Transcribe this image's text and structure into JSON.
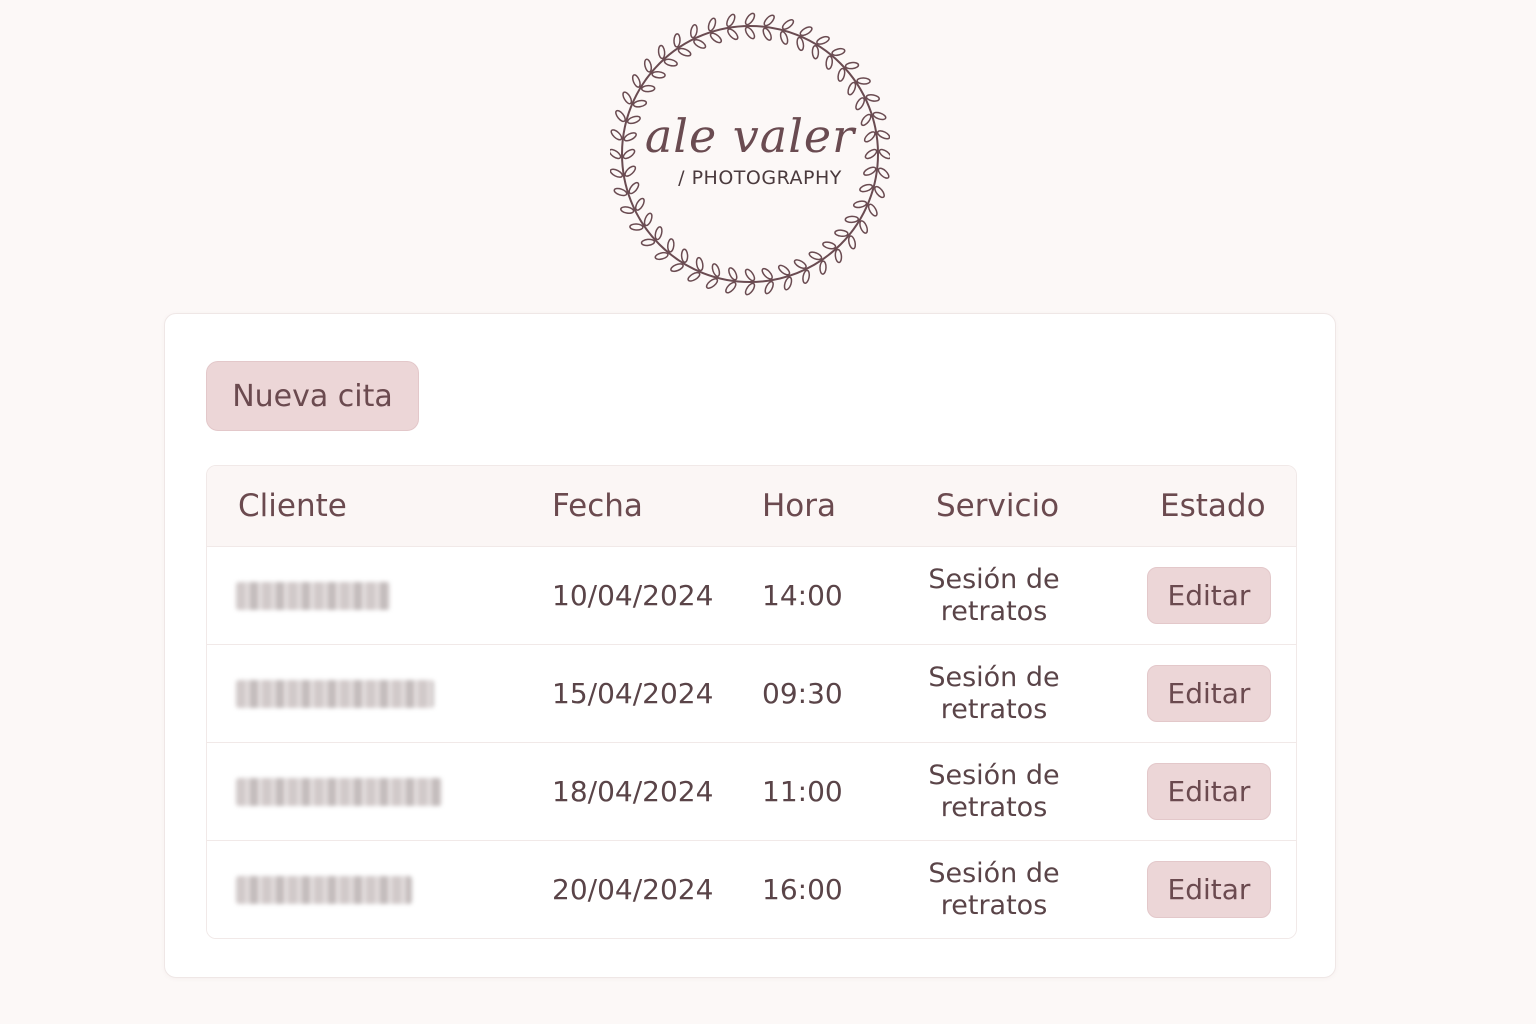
{
  "logo": {
    "script_text": "ale valer",
    "subtitle": "/ PHOTOGRAPHY",
    "ink_color": "#6a4b51"
  },
  "colors": {
    "background": "#fcf8f7",
    "accent": "#ecd6d7",
    "text": "#6b4a4f"
  },
  "new_appointment_label": "Nueva cita",
  "table": {
    "headers": [
      "Cliente",
      "Fecha",
      "Hora",
      "Servicio",
      "Estado"
    ],
    "rows": [
      {
        "client": "",
        "date": "10/04/2024",
        "time": "14:00",
        "service": "Sesión de retratos",
        "action": "Editar"
      },
      {
        "client": "",
        "date": "15/04/2024",
        "time": "09:30",
        "service": "Sesión de retratos",
        "action": "Editar"
      },
      {
        "client": "",
        "date": "18/04/2024",
        "time": "11:00",
        "service": "Sesión de retratos",
        "action": "Editar"
      },
      {
        "client": "",
        "date": "20/04/2024",
        "time": "16:00",
        "service": "Sesión de retratos",
        "action": "Editar"
      }
    ]
  }
}
